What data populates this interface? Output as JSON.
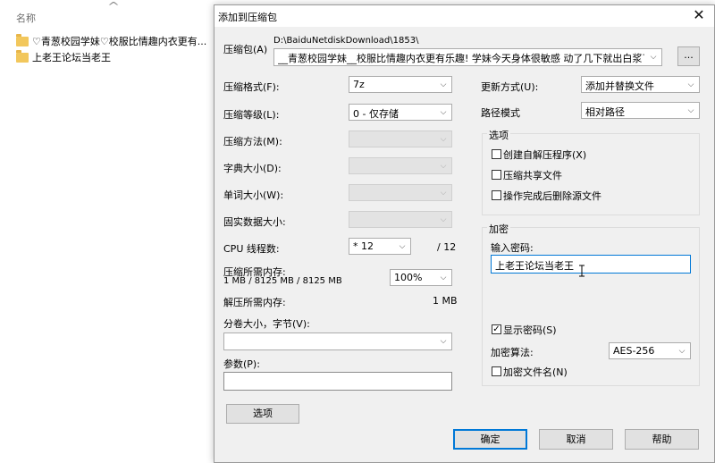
{
  "explorer": {
    "column_header": "名称",
    "files": [
      {
        "name": "♡青葱校园学妹♡校服比情趣内衣更有..."
      },
      {
        "name": "上老王论坛当老王"
      }
    ]
  },
  "dialog": {
    "title": "添加到压缩包",
    "archive": {
      "label": "压缩包(A)",
      "path": "D:\\BaiduNetdiskDownload\\1853\\",
      "filename": "__青葱校园学妹__校服比情趣内衣更有乐趣! 学妹今天身体很敏感 动了几下就出白浆了,",
      "browse_label": "..."
    },
    "left": {
      "format": {
        "label": "压缩格式(F):",
        "value": "7z"
      },
      "level": {
        "label": "压缩等级(L):",
        "value": "0 - 仅存储"
      },
      "method": {
        "label": "压缩方法(M):",
        "value": ""
      },
      "dict": {
        "label": "字典大小(D):",
        "value": ""
      },
      "word": {
        "label": "单词大小(W):",
        "value": ""
      },
      "solid": {
        "label": "固实数据大小:",
        "value": ""
      },
      "cpu": {
        "label": "CPU 线程数:",
        "value": "* 12",
        "max": "/ 12"
      },
      "mem_comp": {
        "label": "压缩所需内存:",
        "detail": "1 MB / 8125 MB / 8125 MB",
        "percent": "100%"
      },
      "mem_decomp": {
        "label": "解压所需内存:",
        "value": "1 MB"
      },
      "volume": {
        "label": "分卷大小，字节(V):",
        "value": ""
      },
      "params": {
        "label": "参数(P):",
        "value": ""
      },
      "options_button": "选项"
    },
    "right": {
      "update": {
        "label": "更新方式(U):",
        "value": "添加并替换文件"
      },
      "path_mode": {
        "label": "路径模式",
        "value": "相对路径"
      },
      "options_group": {
        "title": "选项",
        "sfx": {
          "label": "创建自解压程序(X)",
          "checked": false
        },
        "shared": {
          "label": "压缩共享文件",
          "checked": false
        },
        "delete_after": {
          "label": "操作完成后删除源文件",
          "checked": false
        }
      },
      "encryption_group": {
        "title": "加密",
        "password_label": "输入密码:",
        "password_value": "上老王论坛当老王",
        "show_password": {
          "label": "显示密码(S)",
          "checked": true
        },
        "method_label": "加密算法:",
        "method_value": "AES-256",
        "encrypt_names": {
          "label": "加密文件名(N)",
          "checked": false
        }
      }
    },
    "buttons": {
      "ok": "确定",
      "cancel": "取消",
      "help": "帮助"
    }
  },
  "icons": {
    "close": "close-icon",
    "dropdown": "chevron-down-icon",
    "folder": "folder-icon",
    "check": "checkmark-icon",
    "sort": "sort-up-icon"
  },
  "colors": {
    "dialog_bg": "#f0f0f0",
    "default_button_border": "#0078d7",
    "folder": "#f2c75c"
  }
}
